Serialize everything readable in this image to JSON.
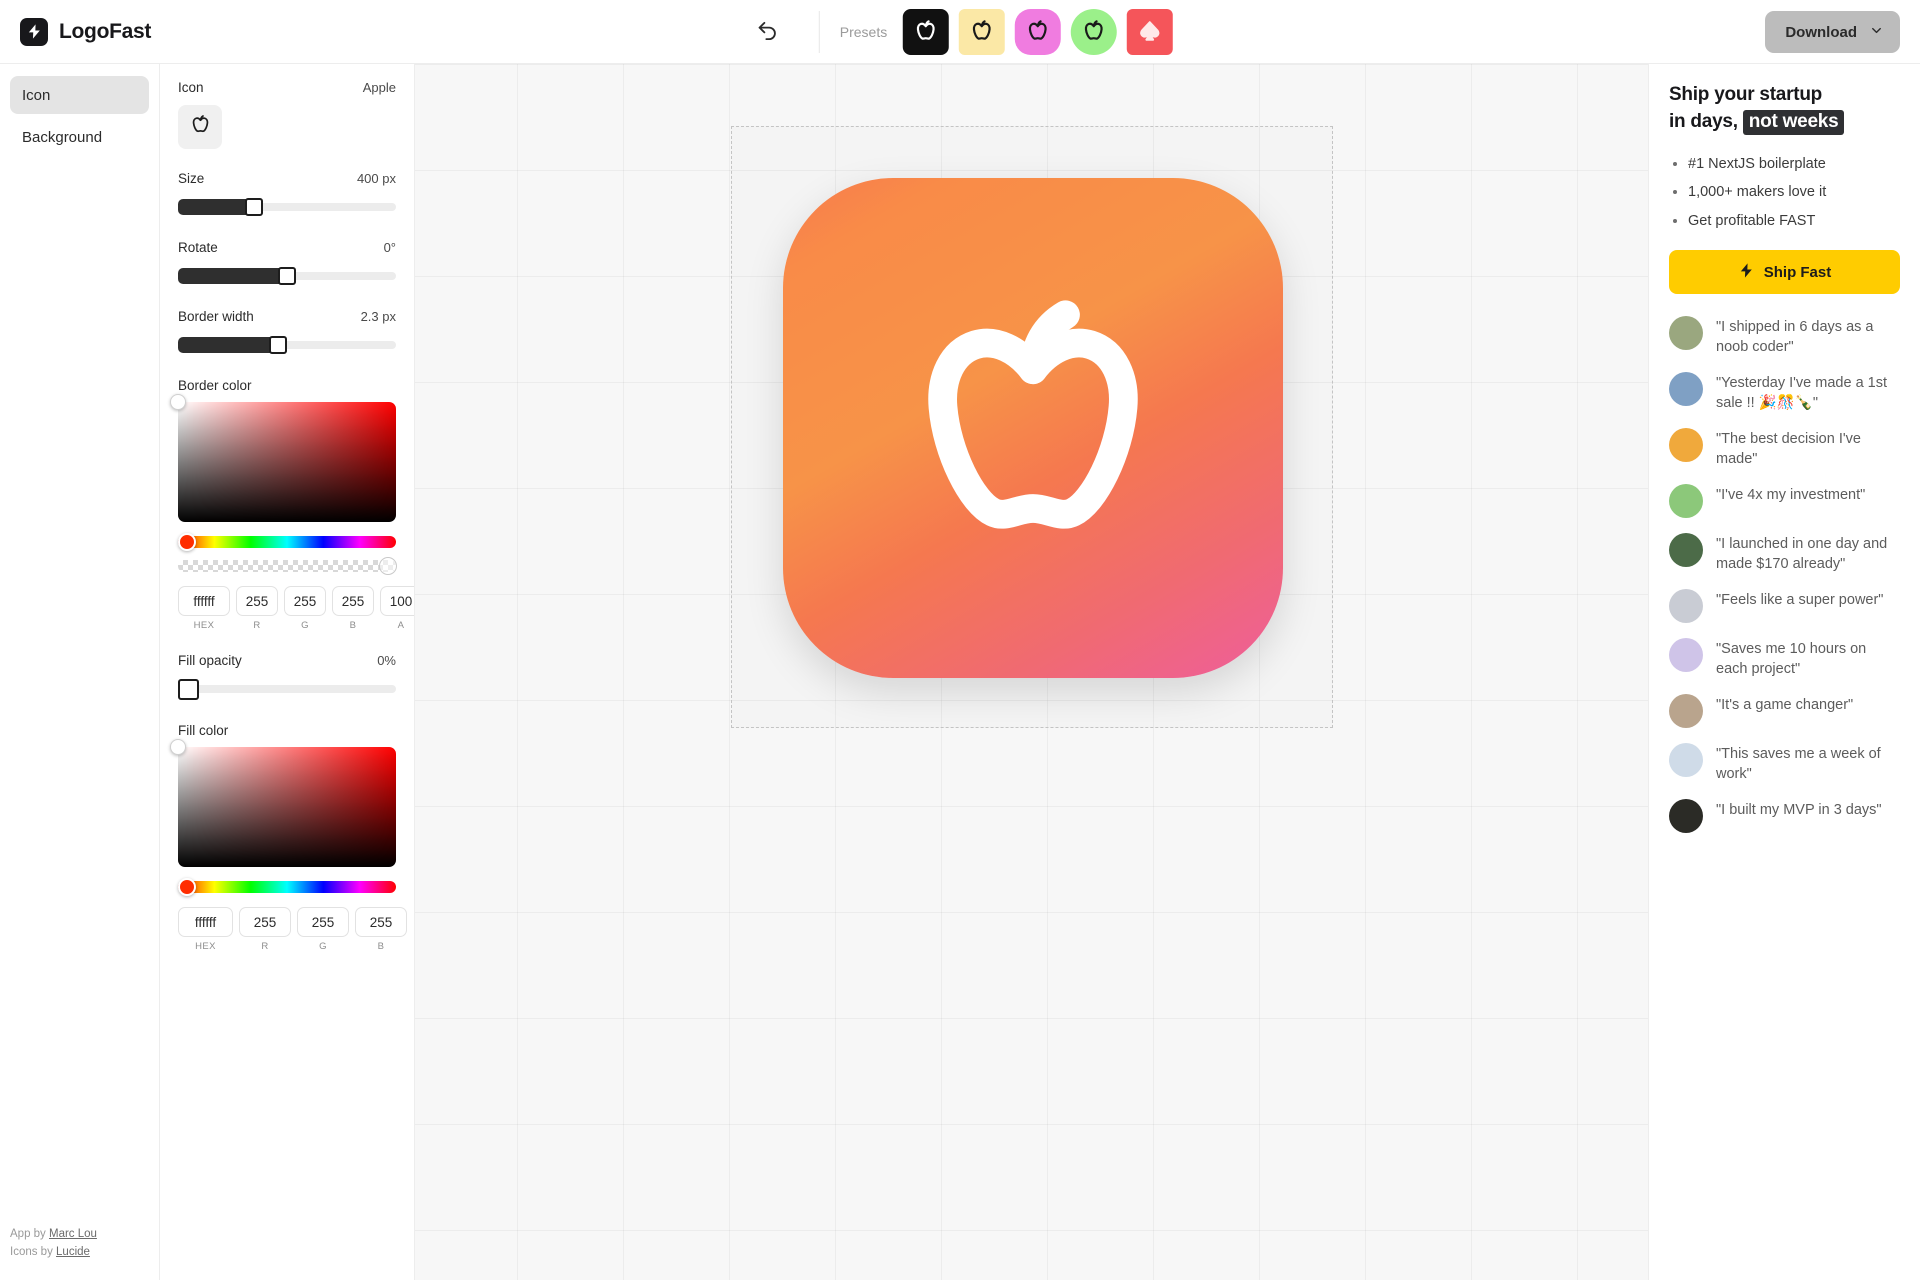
{
  "app": {
    "brand_name": "LogoFast",
    "brand_icon": "bolt-icon"
  },
  "toolbar": {
    "undo_icon": "undo-arrow-icon",
    "presets_label": "Presets",
    "presets": [
      {
        "name": "preset-black",
        "bg": "#111111",
        "stroke": "#ffffff",
        "shape": "apple",
        "radius": "8px"
      },
      {
        "name": "preset-cream",
        "bg": "#fbe8a6",
        "stroke": "#1a1a1a",
        "shape": "apple",
        "radius": "6px"
      },
      {
        "name": "preset-pink",
        "bg": "#f07ce0",
        "stroke": "#1a1a1a",
        "shape": "apple",
        "radius": "16px"
      },
      {
        "name": "preset-green",
        "bg": "#9bf08a",
        "stroke": "#1a1a1a",
        "shape": "apple",
        "radius": "23px"
      },
      {
        "name": "preset-red",
        "bg": "#f5555a",
        "stroke": "#ffe9e9",
        "shape": "spade",
        "radius": "6px"
      }
    ],
    "download_label": "Download",
    "download_chevron": "chevron-down-icon"
  },
  "tabs": [
    {
      "label": "Icon",
      "active": true
    },
    {
      "label": "Background",
      "active": false
    }
  ],
  "credits": {
    "app_by_prefix": "App by ",
    "app_by_link": "Marc Lou",
    "icons_by_prefix": "Icons by ",
    "icons_by_link": "Lucide"
  },
  "panel": {
    "icon": {
      "label": "Icon",
      "value": "Apple",
      "swatch_icon": "apple-icon"
    },
    "size": {
      "label": "Size",
      "value": "400 px",
      "percent": 35
    },
    "rotate": {
      "label": "Rotate",
      "value": "0°",
      "percent": 50
    },
    "border_width": {
      "label": "Border width",
      "value": "2.3 px",
      "percent": 46
    },
    "border_color": {
      "label": "Border color",
      "hex": "ffffff",
      "r": "255",
      "g": "255",
      "b": "255",
      "a": "100",
      "cap_hex": "HEX",
      "cap_r": "R",
      "cap_g": "G",
      "cap_b": "B",
      "cap_a": "A"
    },
    "fill_opacity": {
      "label": "Fill opacity",
      "value": "0%",
      "percent": 0
    },
    "fill_color": {
      "label": "Fill color",
      "hex": "ffffff",
      "r": "255",
      "g": "255",
      "b": "255",
      "cap_hex": "HEX",
      "cap_r": "R",
      "cap_g": "G",
      "cap_b": "B"
    }
  },
  "canvas": {
    "logo_icon": "apple-icon",
    "gradient_start": "#f98b48",
    "gradient_end": "#ee5e9c",
    "stroke_color": "#ffffff"
  },
  "promo": {
    "heading_line1": "Ship your startup",
    "heading_line2_prefix": "in days,",
    "heading_highlight": "not weeks",
    "bullets": [
      "#1 NextJS boilerplate",
      "1,000+ makers love it",
      "Get profitable FAST"
    ],
    "cta_label": "Ship Fast",
    "cta_icon": "bolt-icon",
    "cta_color": "#ffcc00",
    "testimonials": [
      {
        "quote": "\"I shipped in 6 days as a noob coder\"",
        "avatar": "#9aa77f"
      },
      {
        "quote": "\"Yesterday I've made a 1st sale !! 🎉🎊🍾\"",
        "avatar": "#7fa0c4"
      },
      {
        "quote": "\"The best decision I've made\"",
        "avatar": "#f0a93c"
      },
      {
        "quote": "\"I've 4x my investment\"",
        "avatar": "#8cc87a"
      },
      {
        "quote": "\"I launched in one day and made $170 already\"",
        "avatar": "#4c6b48"
      },
      {
        "quote": "\"Feels like a super power\"",
        "avatar": "#c9ccd4"
      },
      {
        "quote": "\"Saves me 10 hours on each project\"",
        "avatar": "#cfc4e8"
      },
      {
        "quote": "\"It's a game changer\"",
        "avatar": "#b9a48d"
      },
      {
        "quote": "\"This saves me a week of work\"",
        "avatar": "#cfdbe8"
      },
      {
        "quote": "\"I built my MVP in 3 days\"",
        "avatar": "#2b2b26"
      }
    ]
  }
}
